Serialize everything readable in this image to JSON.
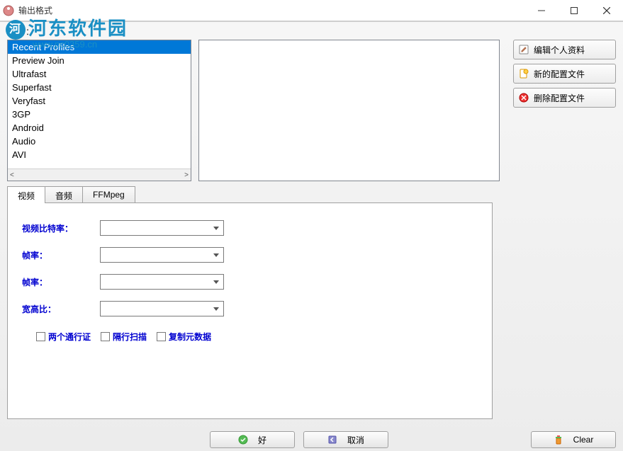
{
  "window": {
    "title": "输出格式"
  },
  "watermark": {
    "brand": "河东软件园",
    "url": "www.pc0359.cn"
  },
  "intro_label": "首介：",
  "profiles": {
    "items": [
      "Recent Profiles",
      "Preview Join",
      "Ultrafast",
      "Superfast",
      "Veryfast",
      "3GP",
      "Android",
      "Audio",
      "AVI"
    ],
    "selected_index": 0
  },
  "actions": {
    "edit": "编辑个人资料",
    "new": "新的配置文件",
    "delete": "删除配置文件"
  },
  "tabs": {
    "video": "视频",
    "audio": "音频",
    "ffmpeg": "FFMpeg"
  },
  "form": {
    "bitrate_label": "视频比特率：",
    "framerate1_label": "帧率：",
    "framerate2_label": "帧率：",
    "aspect_label": "宽高比：",
    "bitrate_value": "",
    "framerate1_value": "",
    "framerate2_value": "",
    "aspect_value": ""
  },
  "checks": {
    "two_pass": "两个通行证",
    "interlace": "隔行扫描",
    "copy_meta": "复制元数据"
  },
  "footer": {
    "ok": "好",
    "cancel": "取消",
    "clear": "Clear"
  }
}
